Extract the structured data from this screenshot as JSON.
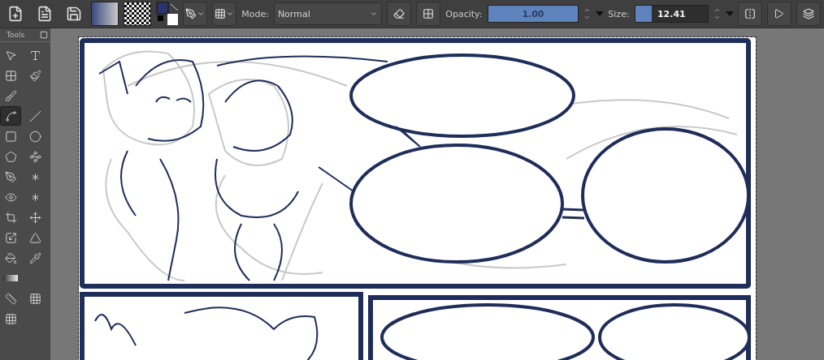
{
  "toolbar": {
    "mode": {
      "label": "Mode:",
      "value": "Normal"
    },
    "opacity": {
      "label": "Opacity:",
      "value": "1.00",
      "level": 1.0
    },
    "size": {
      "label": "Size:",
      "value": "12.41",
      "level": 0.23
    }
  },
  "tools_panel": {
    "title": "Tools",
    "tools": [
      {
        "kind": "pointer",
        "selected": false
      },
      {
        "kind": "text",
        "selected": false
      },
      {
        "kind": "pattern",
        "selected": false
      },
      {
        "kind": "brush",
        "selected": false
      },
      {
        "kind": "multibrush",
        "selected": false
      },
      {
        "kind": "freehand",
        "selected": true
      },
      {
        "kind": "line",
        "selected": false
      },
      {
        "kind": "rectangle",
        "selected": false
      },
      {
        "kind": "ellipse",
        "selected": false
      },
      {
        "kind": "polygon",
        "selected": false
      },
      {
        "kind": "polyline",
        "selected": false
      },
      {
        "kind": "path",
        "selected": false
      },
      {
        "kind": "dynamic",
        "selected": false
      },
      {
        "kind": "eye",
        "selected": false
      },
      {
        "kind": "star",
        "selected": false
      },
      {
        "kind": "crop",
        "selected": false
      },
      {
        "kind": "move",
        "selected": false
      },
      {
        "kind": "transform",
        "selected": false
      },
      {
        "kind": "measure",
        "selected": false
      },
      {
        "kind": "fill",
        "selected": false
      },
      {
        "kind": "picker",
        "selected": false
      },
      {
        "kind": "gradient",
        "selected": false
      },
      {
        "kind": "ruler",
        "selected": false
      },
      {
        "kind": "perspective",
        "selected": false
      },
      {
        "kind": "grid",
        "selected": false
      }
    ]
  }
}
